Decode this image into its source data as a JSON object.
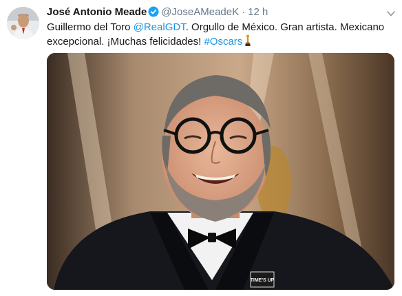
{
  "tweet": {
    "author_name": "José Antonio Meade",
    "author_handle": "@JoseAMeadeK",
    "separator": "·",
    "timestamp": "12 h",
    "text_part1": "Guillermo del Toro ",
    "mention": "@RealGDT",
    "text_part2": ". Orgullo de México. Gran artista. Mexicano excepcional. ¡Muchas felicidades! ",
    "hashtag": "#Oscars",
    "emoji": "oscar-trophy-emoji",
    "media_badge_text": "TIME'S UP"
  },
  "icons": {
    "verified": "verified-badge-icon",
    "caret": "chevron-down-icon"
  },
  "colors": {
    "link": "#1b95e0",
    "verified": "#1da1f2",
    "secondary_text": "#657786",
    "primary_text": "#14171a"
  }
}
